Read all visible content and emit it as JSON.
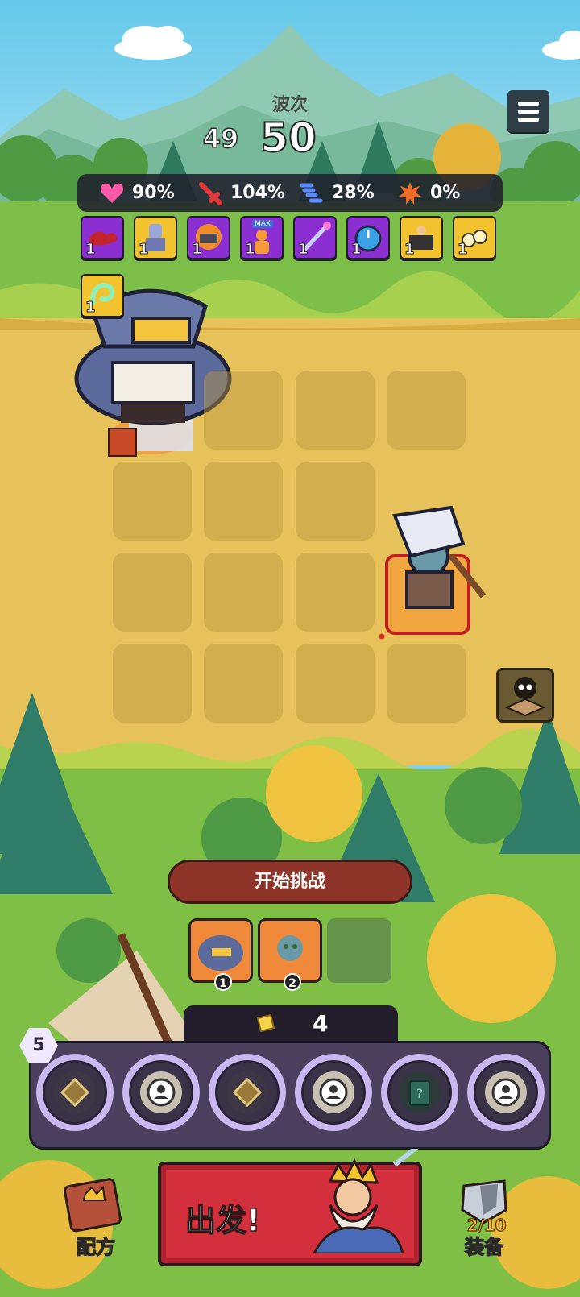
{
  "hud": {
    "wave_label": "波次",
    "wave_previous": "49",
    "wave_current": "50"
  },
  "stats": [
    {
      "icon": "heart-icon",
      "value": "90%",
      "color": "#ff5aa8"
    },
    {
      "icon": "sword-icon",
      "value": "104%",
      "color": "#e23a3a"
    },
    {
      "icon": "speed-icon",
      "value": "28%",
      "color": "#5a8cff"
    },
    {
      "icon": "crit-icon",
      "value": "0%",
      "color": "#f26a2a"
    }
  ],
  "buffs": [
    {
      "name": "blood-splash-buff",
      "count": "1",
      "frame": "purple"
    },
    {
      "name": "knight-statue-buff",
      "count": "1",
      "frame": "gold"
    },
    {
      "name": "fire-anvil-buff",
      "count": "1",
      "frame": "purple"
    },
    {
      "name": "max-hero-buff",
      "count": "1",
      "frame": "purple",
      "tag": "MAX"
    },
    {
      "name": "magic-wand-buff",
      "count": "1",
      "frame": "purple"
    },
    {
      "name": "stopwatch-buff",
      "count": "1",
      "frame": "purple"
    },
    {
      "name": "treasure-chest-buff",
      "count": "1",
      "frame": "gold"
    },
    {
      "name": "gold-pile-buff",
      "count": "1",
      "frame": "gold"
    },
    {
      "name": "ghost-wisp-buff",
      "count": "1",
      "frame": "gold"
    }
  ],
  "actions": {
    "start_challenge": "开始挑战",
    "go": "出发!",
    "recipe": "配方",
    "equipment": "装备",
    "equipment_count": "2/10"
  },
  "queue": [
    {
      "name": "shark-brute-card",
      "badge": "1"
    },
    {
      "name": "zombie-axeman-card",
      "badge": "2"
    }
  ],
  "coins": "4",
  "hero_level": "5",
  "slots": [
    "diamond-slot",
    "hero-slot",
    "diamond-slot",
    "hero-slot",
    "mystery-card-slot",
    "hero-slot"
  ]
}
